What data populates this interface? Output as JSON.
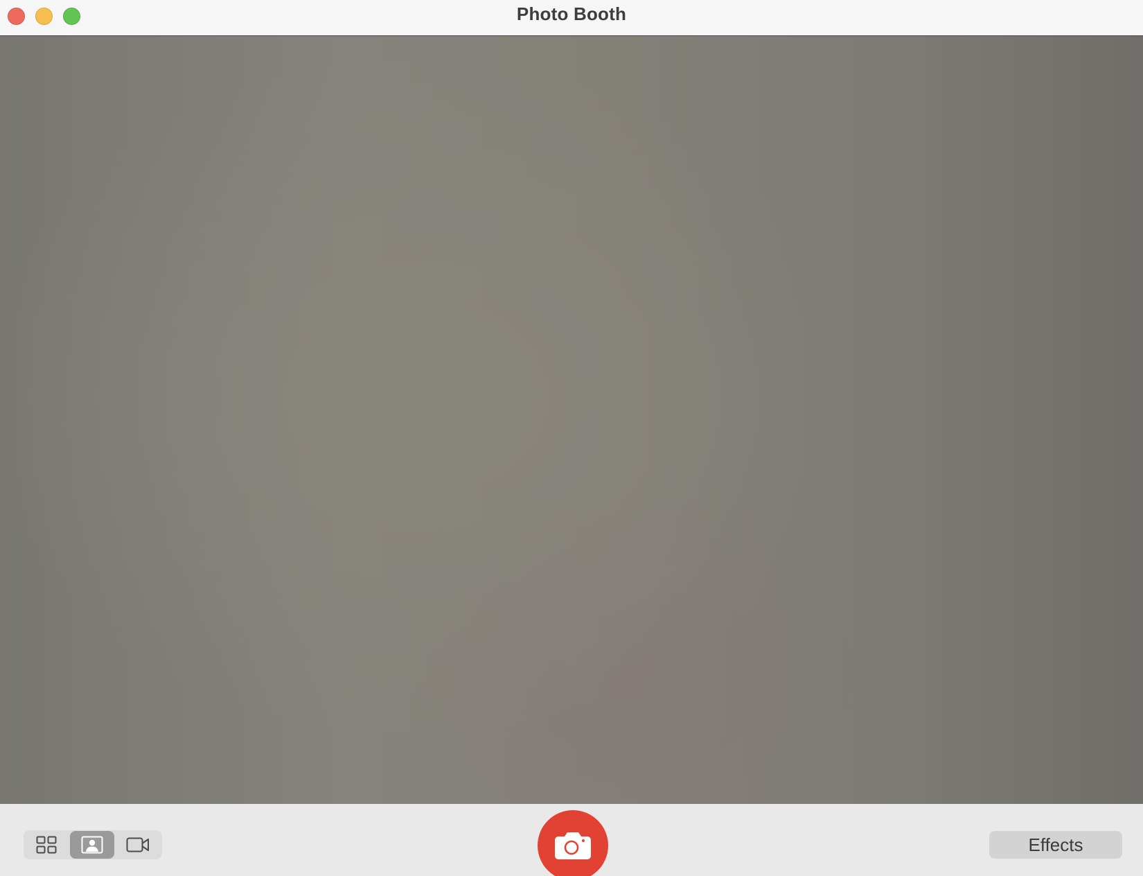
{
  "window": {
    "title": "Photo Booth",
    "controls": {
      "close": "close-button",
      "minimize": "minimize-button",
      "zoom": "zoom-button"
    }
  },
  "toolbar": {
    "view_modes": [
      {
        "id": "grid",
        "icon": "grid-icon",
        "selected": false
      },
      {
        "id": "photo",
        "icon": "portrait-icon",
        "selected": true
      },
      {
        "id": "video",
        "icon": "video-camera-icon",
        "selected": false
      }
    ],
    "shutter": {
      "icon": "camera-icon",
      "color": "#e24234"
    },
    "effects_label": "Effects"
  }
}
